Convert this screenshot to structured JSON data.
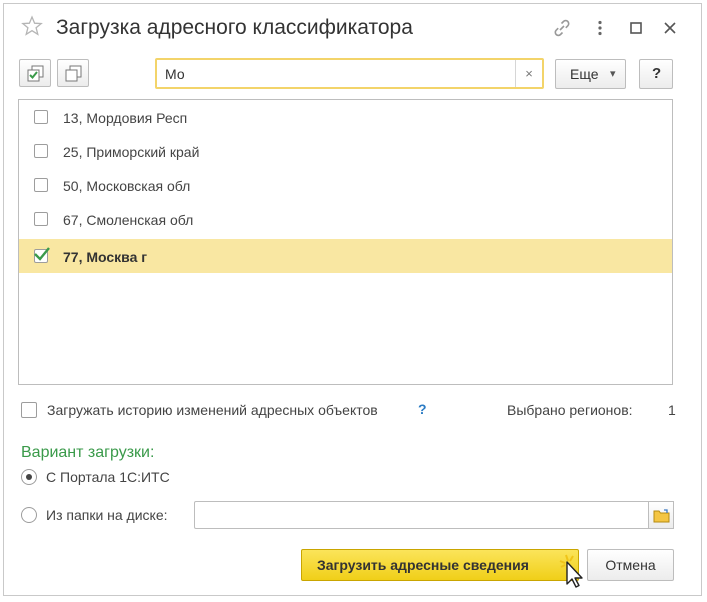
{
  "window": {
    "title": "Загрузка адресного классификатора"
  },
  "toolbar": {
    "search_value": "Мо",
    "clear_symbol": "×",
    "more_label": "Еще",
    "more_arrow": "▾",
    "help_label": "?"
  },
  "regions": [
    {
      "label": "13, Мордовия Респ",
      "checked": false
    },
    {
      "label": "25, Приморский край",
      "checked": false
    },
    {
      "label": "50, Московская обл",
      "checked": false
    },
    {
      "label": "67, Смоленская обл",
      "checked": false
    },
    {
      "label": "77, Москва г",
      "checked": true
    }
  ],
  "history": {
    "label": "Загружать историю изменений адресных объектов",
    "help": "?",
    "selected_label": "Выбрано регионов:",
    "selected_count": "1"
  },
  "load_variant": {
    "title": "Вариант загрузки:",
    "option_portal": "С Портала 1С:ИТС",
    "option_folder": "Из папки на диске:",
    "selected": "portal",
    "folder_path": ""
  },
  "buttons": {
    "load": "Загрузить адресные сведения",
    "cancel": "Отмена"
  },
  "colors": {
    "selected_row": "#f9e7a2",
    "primary_button": "#f0cf18",
    "search_border": "#f3d46a",
    "section_title": "#3a9a4a",
    "help_link": "#2c7cc4"
  },
  "icons": {
    "favorite": "star-icon",
    "link": "link-icon",
    "menu": "more-vertical-icon",
    "maximize": "maximize-icon",
    "close": "close-icon",
    "check_all": "check-all-icon",
    "uncheck_all": "uncheck-all-icon",
    "folder": "folder-icon",
    "cursor": "mouse-cursor-icon"
  }
}
